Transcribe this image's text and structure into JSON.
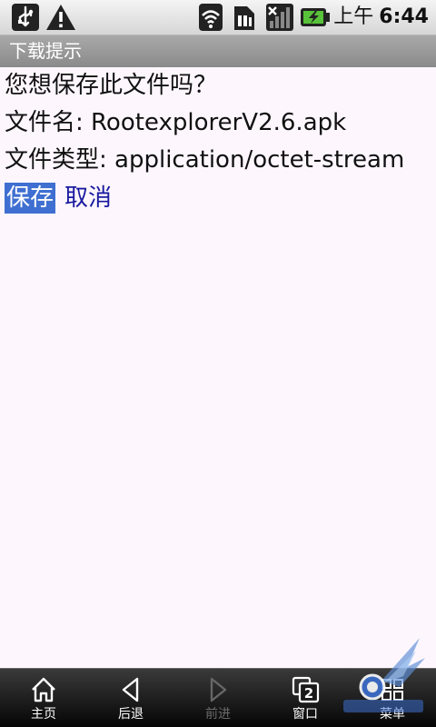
{
  "status_bar": {
    "icons": [
      "usb-icon",
      "warning-icon",
      "wifi-icon",
      "sim-card-icon",
      "signal-bars-icon",
      "battery-charging-icon"
    ],
    "ampm": "上午",
    "time": "6:44"
  },
  "dialog": {
    "title": "下载提示",
    "question": "您想保存此文件吗？",
    "filename_line": "文件名: RootexplorerV2.6.apk",
    "filetype_line": "文件类型: application/octet-stream",
    "save_label": "保存",
    "cancel_label": "取消"
  },
  "toolbar": {
    "items": [
      {
        "label": "主页",
        "icon": "home-icon",
        "enabled": true
      },
      {
        "label": "后退",
        "icon": "back-arrow-icon",
        "enabled": true
      },
      {
        "label": "前进",
        "icon": "forward-arrow-icon",
        "enabled": false
      },
      {
        "label": "窗口",
        "icon": "windows-icon",
        "enabled": true,
        "badge": "2"
      },
      {
        "label": "菜单",
        "icon": "menu-icon",
        "enabled": true
      }
    ]
  },
  "colors": {
    "background": "#fdf7fd",
    "title_bar": "#9a9a9a",
    "link": "#1a1aa0",
    "focus": "#3f6fd1",
    "toolbar": "#1a1a1a"
  }
}
